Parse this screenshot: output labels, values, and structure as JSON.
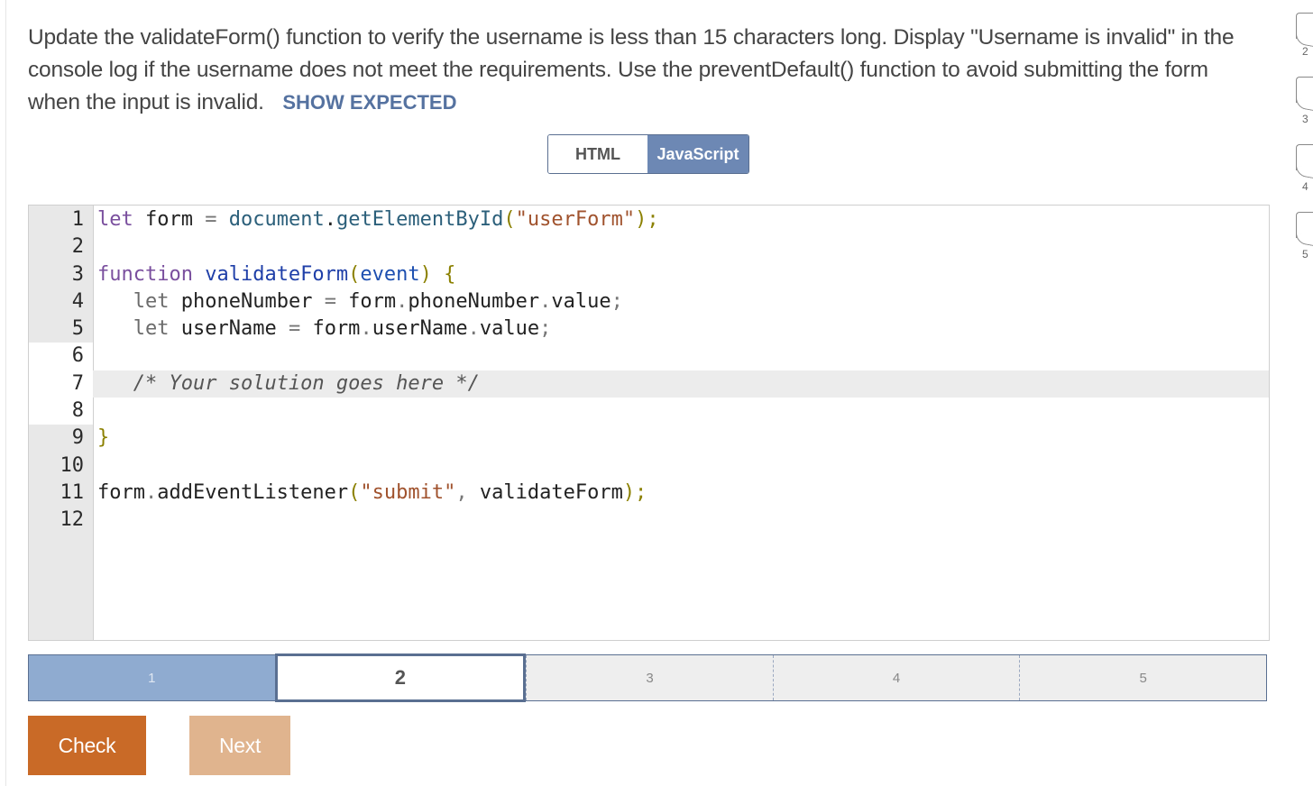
{
  "instructions": {
    "text": "Update the validateForm() function to verify the username is less than 15 characters long. Display \"Username is invalid\" in the console log if the username does not meet the requirements. Use the preventDefault() function to avoid submitting the form when the input is invalid.",
    "show_expected": "SHOW EXPECTED"
  },
  "tabs": [
    {
      "label": "HTML",
      "active": false
    },
    {
      "label": "JavaScript",
      "active": true
    }
  ],
  "editor": {
    "line_numbers": [
      "1",
      "2",
      "3",
      "4",
      "5",
      "6",
      "7",
      "8",
      "9",
      "10",
      "11",
      "12"
    ],
    "active_line": 7
  },
  "progress": {
    "segments": [
      "1",
      "2",
      "3",
      "4",
      "5"
    ],
    "completed": 1,
    "current": 2
  },
  "buttons": {
    "check": "Check",
    "next": "Next"
  },
  "side_nav": [
    "2",
    "3",
    "4",
    "5"
  ],
  "colors": {
    "accent": "#6d88b4",
    "check_button": "#c96a27",
    "next_button": "#e0b48e",
    "link": "#5572a0"
  }
}
